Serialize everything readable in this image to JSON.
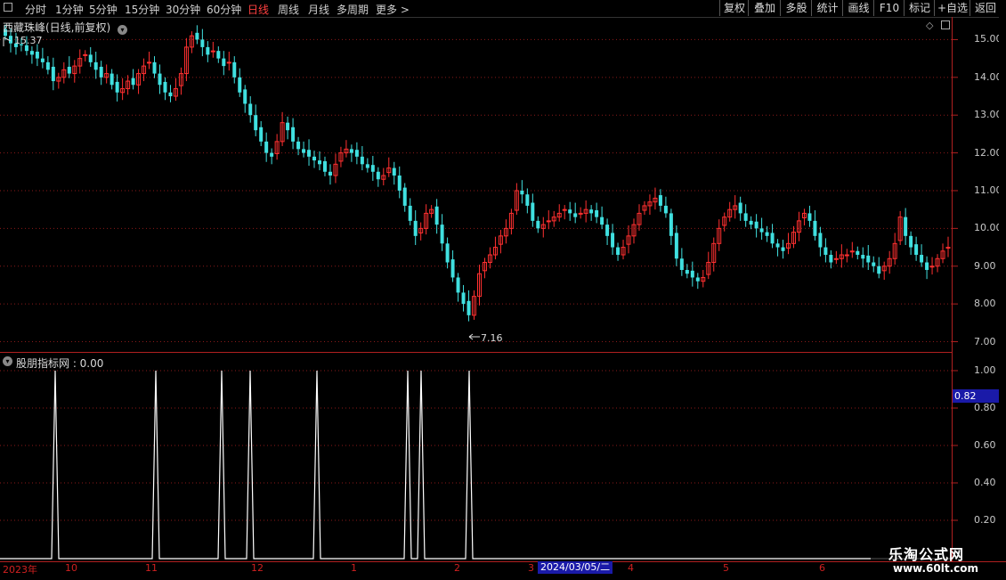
{
  "toolbar": {
    "periods": [
      "分时",
      "1分钟",
      "5分钟",
      "15分钟",
      "30分钟",
      "60分钟",
      "日线",
      "周线",
      "月线",
      "多周期",
      "更多 >"
    ],
    "active_period": "日线",
    "buttons": [
      "复权",
      "叠加",
      "多股",
      "统计",
      "画线",
      "F10",
      "标记",
      "+自选",
      "返回"
    ]
  },
  "chart_title": "西藏珠峰(日线,前复权)",
  "price_axis": [
    "15.00",
    "14.00",
    "13.00",
    "12.00",
    "11.00",
    "10.00",
    "9.00",
    "8.00",
    "7.00"
  ],
  "high_label": "15.37",
  "low_label": "7.16",
  "indicator": {
    "title": "股朋指标网 : 0.00",
    "axis": [
      "1.00",
      "0.80",
      "0.60",
      "0.40",
      "0.20"
    ],
    "current_value": "0.82"
  },
  "date_axis": {
    "labels": [
      "2023年",
      "10",
      "11",
      "12",
      "1",
      "2",
      "3",
      "4",
      "5",
      "6"
    ],
    "highlight": "2024/03/05/二"
  },
  "watermark": {
    "line1": "乐淘公式网",
    "line2": "www.60lt.com"
  },
  "colors": {
    "up": "#ff3030",
    "down": "#40e0e0",
    "grid": "#8b1a1a",
    "signal": "#ffffff"
  },
  "chart_data": {
    "type": "candlestick",
    "y_range": [
      6.8,
      15.6
    ],
    "high": 15.37,
    "low": 7.16,
    "close_series": [
      15.1,
      14.9,
      14.8,
      14.85,
      14.7,
      14.6,
      14.5,
      14.4,
      14.2,
      13.9,
      14.0,
      14.2,
      14.1,
      14.3,
      14.5,
      14.6,
      14.4,
      14.2,
      14.0,
      14.1,
      13.8,
      13.6,
      13.7,
      13.9,
      13.8,
      14.1,
      14.3,
      14.4,
      14.1,
      13.8,
      13.6,
      13.5,
      13.7,
      14.1,
      14.8,
      15.1,
      15.0,
      14.8,
      14.6,
      14.7,
      14.5,
      14.3,
      14.4,
      14.0,
      13.6,
      13.3,
      13.0,
      12.6,
      12.3,
      12.0,
      11.9,
      12.3,
      12.8,
      12.6,
      12.3,
      12.1,
      12.0,
      11.9,
      11.8,
      11.7,
      11.5,
      11.4,
      11.7,
      12.0,
      12.1,
      12.0,
      11.9,
      11.7,
      11.6,
      11.5,
      11.3,
      11.4,
      11.6,
      11.4,
      11.0,
      10.6,
      10.2,
      9.8,
      10.0,
      10.4,
      10.5,
      10.1,
      9.6,
      9.1,
      8.7,
      8.3,
      8.0,
      7.7,
      8.2,
      8.8,
      9.1,
      9.3,
      9.5,
      9.8,
      10.0,
      10.4,
      11.0,
      10.9,
      10.6,
      10.2,
      10.0,
      10.1,
      10.2,
      10.3,
      10.4,
      10.5,
      10.4,
      10.3,
      10.4,
      10.5,
      10.4,
      10.3,
      10.1,
      9.8,
      9.5,
      9.3,
      9.5,
      9.8,
      10.1,
      10.4,
      10.6,
      10.7,
      10.8,
      10.6,
      10.4,
      9.8,
      9.2,
      8.9,
      8.8,
      8.7,
      8.6,
      8.7,
      9.1,
      9.6,
      10.0,
      10.3,
      10.5,
      10.6,
      10.4,
      10.2,
      10.1,
      10.0,
      9.9,
      9.8,
      9.6,
      9.5,
      9.4,
      9.6,
      9.9,
      10.2,
      10.4,
      10.2,
      9.8,
      9.5,
      9.3,
      9.1,
      9.2,
      9.3,
      9.3,
      9.4,
      9.3,
      9.2,
      9.1,
      9.0,
      8.8,
      9.0,
      9.2,
      9.6,
      10.3,
      9.8,
      9.5,
      9.3,
      9.1,
      8.9,
      9.0,
      9.2,
      9.4,
      9.5
    ],
    "signal_x": [
      62,
      175,
      249,
      281,
      356,
      458,
      473,
      527
    ],
    "indicator_range": [
      0,
      1.0
    ],
    "signal_value": 1.0
  }
}
